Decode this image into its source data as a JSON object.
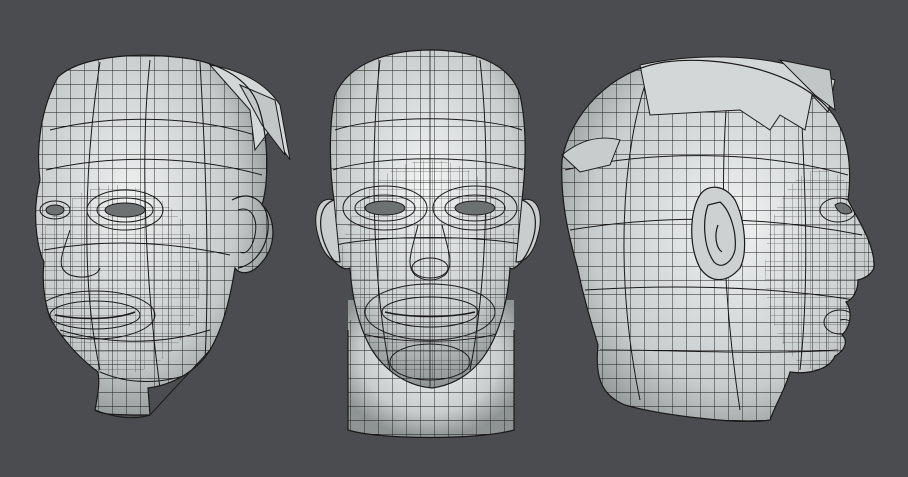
{
  "scene": {
    "background": "#4a4c50",
    "mesh_fill": "#d9dcdc",
    "mesh_shadow": "#8f9494",
    "wire": "#1c1c1c",
    "views": [
      {
        "id": "three-quarter",
        "icon": "head-mesh-icon"
      },
      {
        "id": "front",
        "icon": "head-mesh-icon"
      },
      {
        "id": "side",
        "icon": "head-mesh-icon"
      }
    ]
  }
}
